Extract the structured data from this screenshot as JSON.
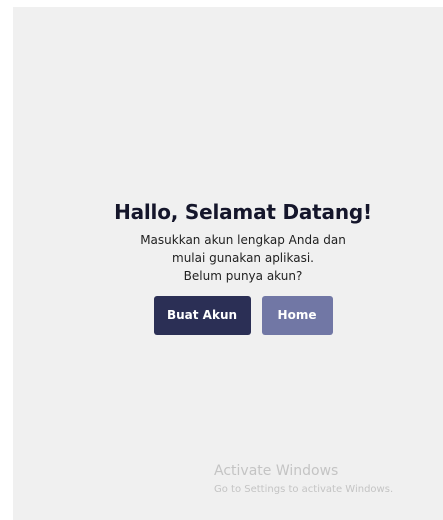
{
  "welcome": {
    "title": "Hallo, Selamat Datang!",
    "description_lines": [
      "Masukkan akun lengkap Anda dan",
      "mulai gunakan aplikasi.",
      "Belum punya akun?"
    ],
    "buttons": {
      "create_account": "Buat Akun",
      "home": "Home"
    }
  },
  "watermark": {
    "title": "Activate Windows",
    "subtitle": "Go to Settings to activate Windows."
  },
  "colors": {
    "primary_button": "#2b2f55",
    "secondary_button": "#7177a5",
    "panel_background": "#f0f0f0",
    "title_text": "#15162b"
  }
}
